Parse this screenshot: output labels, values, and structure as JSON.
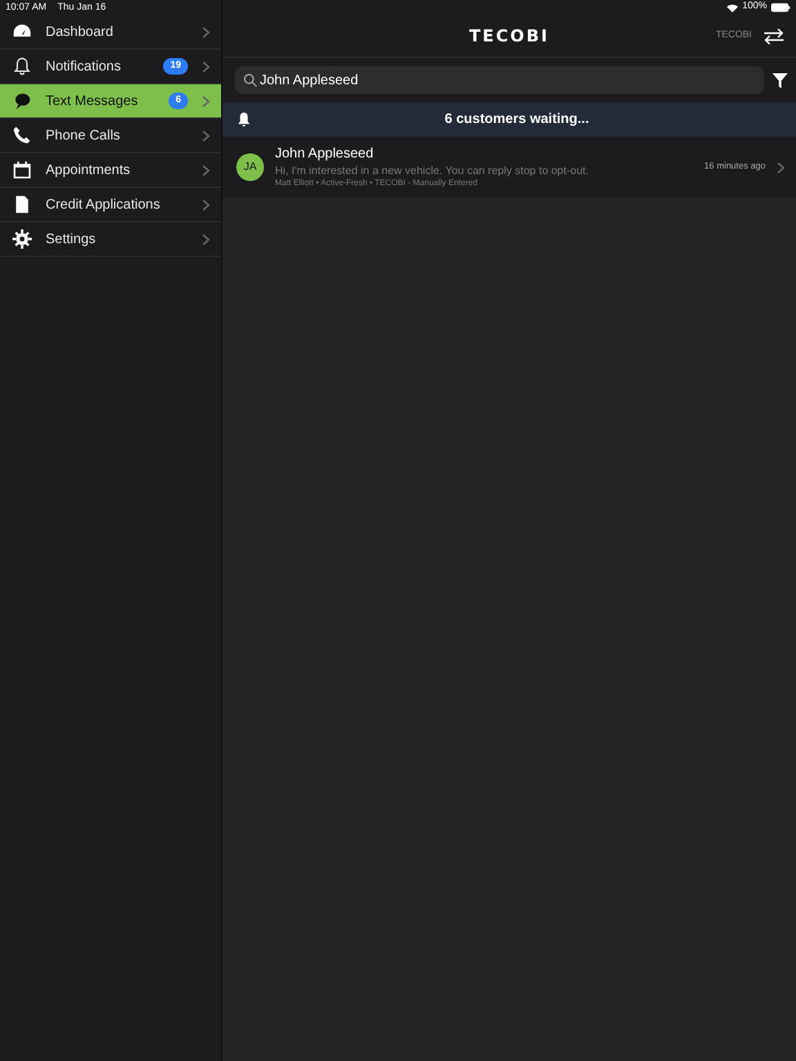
{
  "status_bar": {
    "time": "10:07 AM",
    "date": "Thu Jan 16",
    "battery": "100%"
  },
  "sidebar": {
    "items": [
      {
        "label": "Dashboard",
        "selected": false
      },
      {
        "label": "Notifications",
        "badge": "19",
        "selected": false
      },
      {
        "label": "Text Messages",
        "badge": "6",
        "selected": true
      },
      {
        "label": "Phone Calls",
        "selected": false
      },
      {
        "label": "Appointments",
        "selected": false
      },
      {
        "label": "Credit Applications",
        "selected": false
      },
      {
        "label": "Settings",
        "selected": false
      }
    ]
  },
  "header": {
    "logo": "TECOBI",
    "account": "TECOBI"
  },
  "search": {
    "value": "John Appleseed"
  },
  "banner": {
    "text": "6 customers waiting..."
  },
  "conversations": [
    {
      "initials": "JA",
      "name": "John Appleseed",
      "message": "Hi, I'm interested in a new vehicle. You can reply stop to opt-out.",
      "meta": "Matt Elliott • Active-Fresh • TECOBI - Manually Entered",
      "time": "16 minutes ago"
    }
  ]
}
